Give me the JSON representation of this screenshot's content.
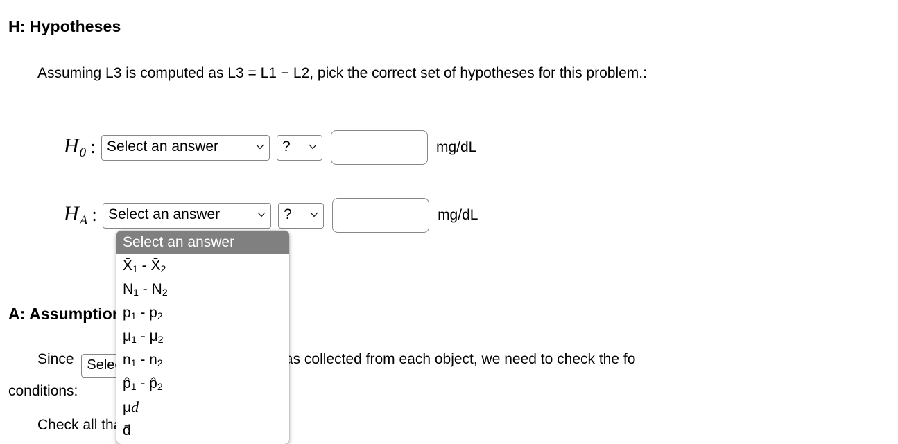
{
  "hypotheses_section": {
    "heading": "H: Hypotheses",
    "intro": "Assuming L3 is computed as L3 = L1 − L2, pick the correct set of hypotheses for this problem.:",
    "rows": [
      {
        "label": "H",
        "subscript": "0",
        "colon": ":",
        "parameter_select_value": "Select an answer",
        "comparator_select_value": "?",
        "value_input": "",
        "value_placeholder": "",
        "unit": "mg/dL"
      },
      {
        "label": "H",
        "subscript": "A",
        "colon": ":",
        "parameter_select_value": "Select an answer",
        "comparator_select_value": "?",
        "value_input": "",
        "value_placeholder": "",
        "unit": "mg/dL"
      }
    ]
  },
  "dropdown": {
    "open": true,
    "highlighted_index": 0,
    "highlight_bg": "#808080",
    "highlight_fg": "#ffffff",
    "options": [
      {
        "text": "Select an answer",
        "base": "Select an answer",
        "sub1": "",
        "mid": "",
        "base2": "",
        "sub2": "",
        "selected": true
      },
      {
        "text": "X̄1 - X̄2",
        "base": "X̄",
        "sub1": "1",
        "mid": " - ",
        "base2": "X̄",
        "sub2": "2",
        "selected": false
      },
      {
        "text": "N1 - N2",
        "base": "N",
        "sub1": "1",
        "mid": " - ",
        "base2": "N",
        "sub2": "2",
        "selected": false
      },
      {
        "text": "p1 - p2",
        "base": "p",
        "sub1": "1",
        "mid": " - ",
        "base2": "p",
        "sub2": "2",
        "selected": false
      },
      {
        "text": "μ1 - μ2",
        "base": "μ",
        "sub1": "1",
        "mid": " - ",
        "base2": "μ",
        "sub2": "2",
        "selected": false
      },
      {
        "text": "n1 - n2",
        "base": "n",
        "sub1": "1",
        "mid": " - ",
        "base2": "n",
        "sub2": "2",
        "selected": false
      },
      {
        "text": "p̂1 - p̂2",
        "base": "p̂",
        "sub1": "1",
        "mid": " - ",
        "base2": "p̂",
        "sub2": "2",
        "selected": false
      },
      {
        "text": "μd",
        "base": "μ",
        "sub1": "",
        "mid": "",
        "base2": "",
        "sub2": "",
        "italic_tail": "d",
        "selected": false
      },
      {
        "text": "d̄",
        "base": "d̄",
        "sub1": "",
        "mid": "",
        "base2": "",
        "sub2": "",
        "selected": false
      }
    ]
  },
  "assumptions_section": {
    "heading": "A: Assumptions",
    "since_prefix": "Since",
    "since_select_value": "Select an answer",
    "since_suffix": "formation was collected from each object, we need to check the fo",
    "conditions_label": "conditions:",
    "check_line": "Check all that apply."
  },
  "icons": {
    "chevron_down": "chevron-down-icon"
  },
  "colors": {
    "page_background": "#ffffff",
    "text": "#000000",
    "control_border": "#878787",
    "dropdown_highlight": "#808080"
  }
}
